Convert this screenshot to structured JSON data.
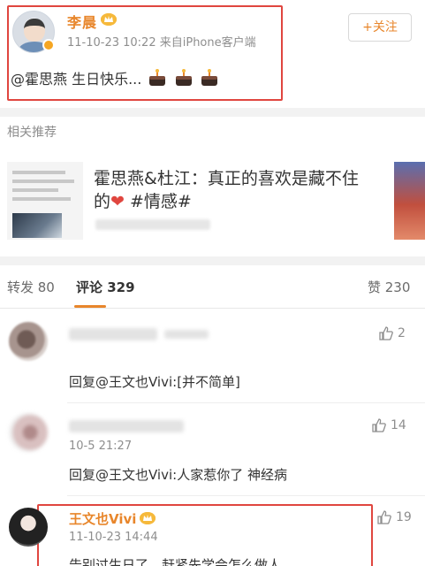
{
  "post": {
    "author": "李晨",
    "meta": "11-10-23 10:22  来自iPhone客户端",
    "text": "@霍思燕 生日快乐...",
    "follow_label": "+关注",
    "cake_icon": "cake-icon",
    "accent": "#e8862b",
    "highlight": "#e0463f"
  },
  "related": {
    "section_title": "相关推荐",
    "title_main": "霍思燕&杜江：真正的喜欢是藏不住的",
    "heart": "❤",
    "tag": " #情感#"
  },
  "tabs": {
    "repost": "转发 80",
    "comment": "评论 329",
    "like": "赞 230"
  },
  "comments": [
    {
      "time": "",
      "text": "回复@王文也Vivi:[并不简单]",
      "likes": "2"
    },
    {
      "time": "10-5 21:27",
      "text": "回复@王文也Vivi:人家惹你了 神经病",
      "likes": "14"
    },
    {
      "name": "王文也Vivi",
      "time": "11-10-23 14:44",
      "text": "告别过生日了，赶紧先学会怎么做人",
      "likes": "19"
    }
  ]
}
